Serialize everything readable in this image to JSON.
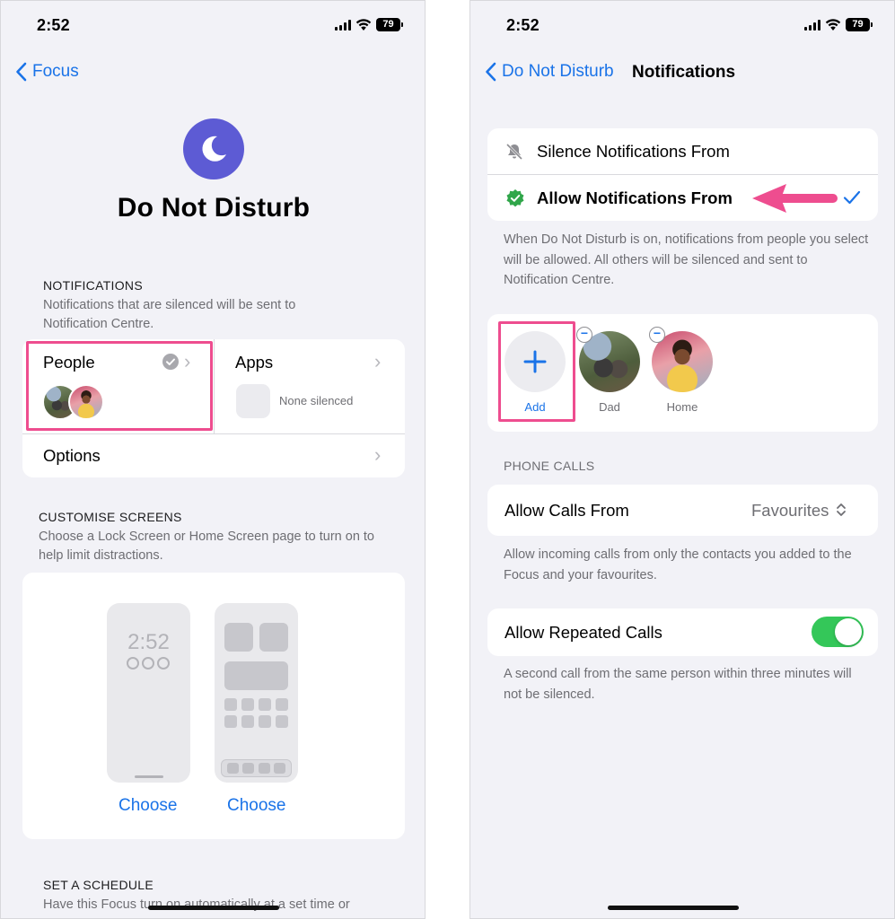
{
  "colors": {
    "accent": "#1a73e8",
    "focus_purple": "#5d5bd4",
    "highlight_pink": "#ee4d8f",
    "toggle_green": "#34c759",
    "verified_green": "#30a64a"
  },
  "left": {
    "status": {
      "time": "2:52",
      "battery": "79"
    },
    "nav": {
      "back_label": "Focus"
    },
    "focus": {
      "icon": "moon-icon",
      "title": "Do Not Disturb"
    },
    "notifications": {
      "header": "NOTIFICATIONS",
      "description": "Notifications that are silenced will be sent to Notification Centre.",
      "people_label": "People",
      "apps_label": "Apps",
      "apps_status": "None silenced",
      "options_label": "Options"
    },
    "customise": {
      "header": "CUSTOMISE SCREENS",
      "description": "Choose a Lock Screen or Home Screen page to turn on to help limit distractions.",
      "lock_time": "2:52",
      "choose_lock": "Choose",
      "choose_home": "Choose"
    },
    "schedule": {
      "header": "SET A SCHEDULE",
      "description": "Have this Focus turn on automatically at a set time or"
    }
  },
  "right": {
    "status": {
      "time": "2:52",
      "battery": "79"
    },
    "nav": {
      "back_label": "Do Not Disturb",
      "title": "Notifications"
    },
    "mode": {
      "silence_label": "Silence Notifications From",
      "allow_label": "Allow Notifications From",
      "selected": "Allow Notifications From"
    },
    "mode_description": "When Do Not Disturb is on, notifications from people you select will be allowed. All others will be silenced and sent to Notification Centre.",
    "people": [
      {
        "label": "Add"
      },
      {
        "label": "Dad"
      },
      {
        "label": "Home"
      }
    ],
    "phone_calls": {
      "header": "PHONE CALLS",
      "allow_calls_label": "Allow Calls From",
      "allow_calls_value": "Favourites",
      "allow_calls_description": "Allow incoming calls from only the contacts you added to the Focus and your favourites.",
      "repeated_label": "Allow Repeated Calls",
      "repeated_on": true,
      "repeated_description": "A second call from the same person within three minutes will not be silenced."
    }
  }
}
